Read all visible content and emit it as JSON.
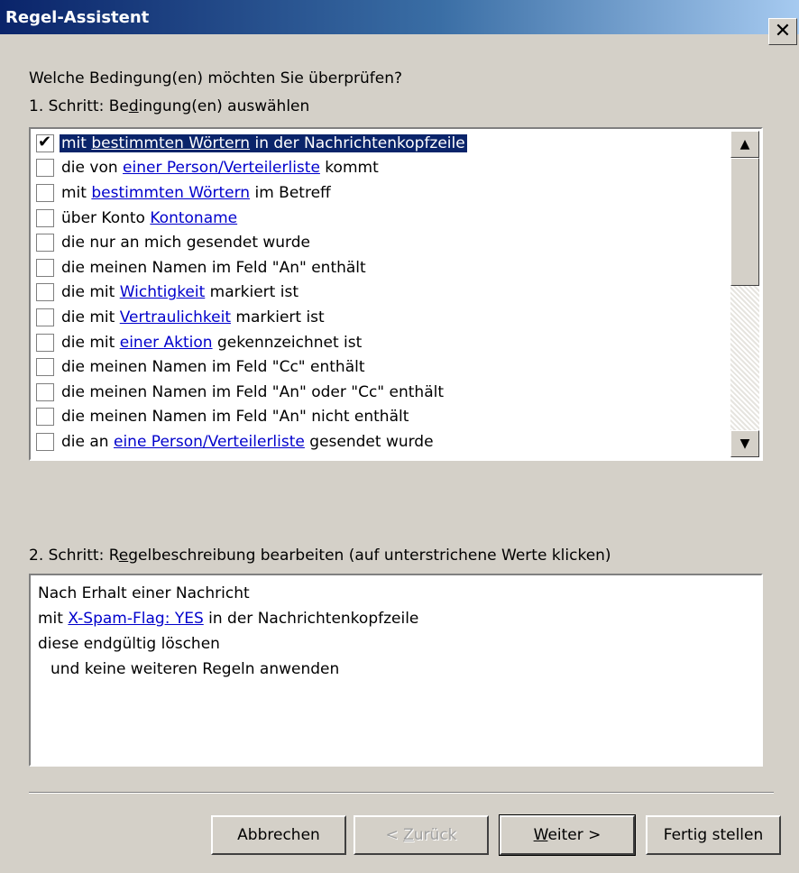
{
  "window": {
    "title": "Regel-Assistent",
    "close_glyph": "✕"
  },
  "question": "Welche Bedingung(en) möchten Sie überprüfen?",
  "step1": {
    "prefix": "1. Schritt: Be",
    "accel": "d",
    "suffix": "ingung(en) auswählen"
  },
  "conditions": [
    {
      "checked": true,
      "selected": true,
      "pre": "mit ",
      "link": "bestimmten Wörtern",
      "post": " in der Nachrichtenkopfzeile"
    },
    {
      "checked": false,
      "selected": false,
      "pre": "die von ",
      "link": "einer Person/Verteilerliste",
      "post": " kommt"
    },
    {
      "checked": false,
      "selected": false,
      "pre": "mit ",
      "link": "bestimmten Wörtern",
      "post": " im Betreff"
    },
    {
      "checked": false,
      "selected": false,
      "pre": "über Konto ",
      "link": "Kontoname",
      "post": ""
    },
    {
      "checked": false,
      "selected": false,
      "pre": "die nur an mich gesendet wurde",
      "link": "",
      "post": ""
    },
    {
      "checked": false,
      "selected": false,
      "pre": "die meinen Namen im Feld \"An\" enthält",
      "link": "",
      "post": ""
    },
    {
      "checked": false,
      "selected": false,
      "pre": "die mit ",
      "link": "Wichtigkeit",
      "post": " markiert ist"
    },
    {
      "checked": false,
      "selected": false,
      "pre": "die mit ",
      "link": "Vertraulichkeit",
      "post": " markiert ist"
    },
    {
      "checked": false,
      "selected": false,
      "pre": "die mit ",
      "link": "einer Aktion",
      "post": " gekennzeichnet ist"
    },
    {
      "checked": false,
      "selected": false,
      "pre": "die meinen Namen im Feld \"Cc\" enthält",
      "link": "",
      "post": ""
    },
    {
      "checked": false,
      "selected": false,
      "pre": "die meinen Namen im Feld \"An\" oder \"Cc\" enthält",
      "link": "",
      "post": ""
    },
    {
      "checked": false,
      "selected": false,
      "pre": "die meinen Namen im Feld \"An\" nicht enthält",
      "link": "",
      "post": ""
    },
    {
      "checked": false,
      "selected": false,
      "pre": "die an ",
      "link": "eine Person/Verteilerliste",
      "post": " gesendet wurde"
    }
  ],
  "step2": {
    "prefix": "2. Schritt: R",
    "accel": "e",
    "suffix": "gelbeschreibung bearbeiten (auf unterstrichene Werte klicken)"
  },
  "description": {
    "line1": "Nach Erhalt einer Nachricht",
    "line2_pre": "mit ",
    "line2_link": "X-Spam-Flag: YES",
    "line2_post": " in der Nachrichtenkopfzeile",
    "line3": "diese endgültig löschen",
    "line4": "und keine weiteren Regeln anwenden"
  },
  "buttons": {
    "cancel": "Abbrechen",
    "back_prefix": "< ",
    "back_accel": "Z",
    "back_suffix": "urück",
    "next_accel": "W",
    "next_suffix": "eiter >",
    "finish": "Fertig stellen"
  },
  "scroll_up_glyph": "▲",
  "scroll_down_glyph": "▼"
}
